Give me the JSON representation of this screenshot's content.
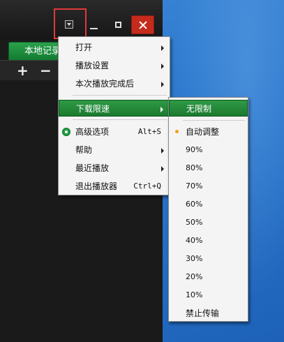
{
  "player": {
    "tab_local": "本地记录"
  },
  "toolbar": {
    "add": "+",
    "remove": "−"
  },
  "main_menu": {
    "items": [
      {
        "label": "打开",
        "submenu": true
      },
      {
        "label": "播放设置",
        "submenu": true
      },
      {
        "label": "本次播放完成后",
        "submenu": true
      },
      {
        "label": "下载限速",
        "submenu": true,
        "highlighted": true
      },
      {
        "label": "高级选项",
        "shortcut": "Alt+S",
        "icon": "gear-icon"
      },
      {
        "label": "帮助",
        "submenu": true
      },
      {
        "label": "最近播放",
        "submenu": true
      },
      {
        "label": "退出播放器",
        "shortcut": "Ctrl+Q"
      }
    ]
  },
  "speed_menu": {
    "items": [
      {
        "label": "无限制",
        "highlighted": true
      },
      {
        "label": "自动调整",
        "selected": true
      },
      {
        "label": "90%"
      },
      {
        "label": "80%"
      },
      {
        "label": "70%"
      },
      {
        "label": "60%"
      },
      {
        "label": "50%"
      },
      {
        "label": "40%"
      },
      {
        "label": "30%"
      },
      {
        "label": "20%"
      },
      {
        "label": "10%"
      },
      {
        "label": "禁止传输"
      }
    ]
  },
  "colors": {
    "accent_green": "#1b7a30",
    "close_red": "#c42b1c",
    "annotation_red": "#e03a3a",
    "selected_bullet": "#f0a020"
  }
}
